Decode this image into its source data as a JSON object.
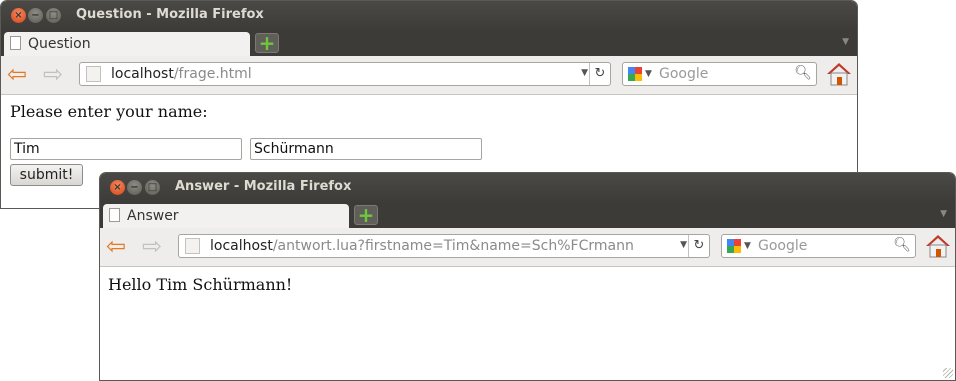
{
  "window1": {
    "title": "Question - Mozilla Firefox",
    "window_buttons": {
      "close": "×",
      "minimize": "−",
      "maximize": "□"
    },
    "tab_label": "Question",
    "new_tab": "+",
    "url_host": "localhost",
    "url_path": "/frage.html",
    "search_placeholder": "Google",
    "prompt": "Please enter your name:",
    "firstname_value": "Tim",
    "lastname_value": "Schürmann",
    "submit_label": "submit!"
  },
  "window2": {
    "title": "Answer - Mozilla Firefox",
    "window_buttons": {
      "close": "×",
      "minimize": "−",
      "maximize": "□"
    },
    "tab_label": "Answer",
    "new_tab": "+",
    "url_host": "localhost",
    "url_path": "/antwort.lua?firstname=Tim&name=Sch%FCrmann",
    "search_placeholder": "Google",
    "greeting": "Hello Tim Schürmann!"
  },
  "icons": {
    "back": "arrow-left-icon",
    "forward": "arrow-right-icon",
    "reload": "reload-icon",
    "search": "magnifier-icon",
    "home": "home-icon",
    "engine": "google-icon"
  },
  "colors": {
    "titlebar": "#3c3b37",
    "close_button": "#e0582a",
    "new_tab_plus": "#6fc73c",
    "back_arrow": "#e07a23"
  }
}
